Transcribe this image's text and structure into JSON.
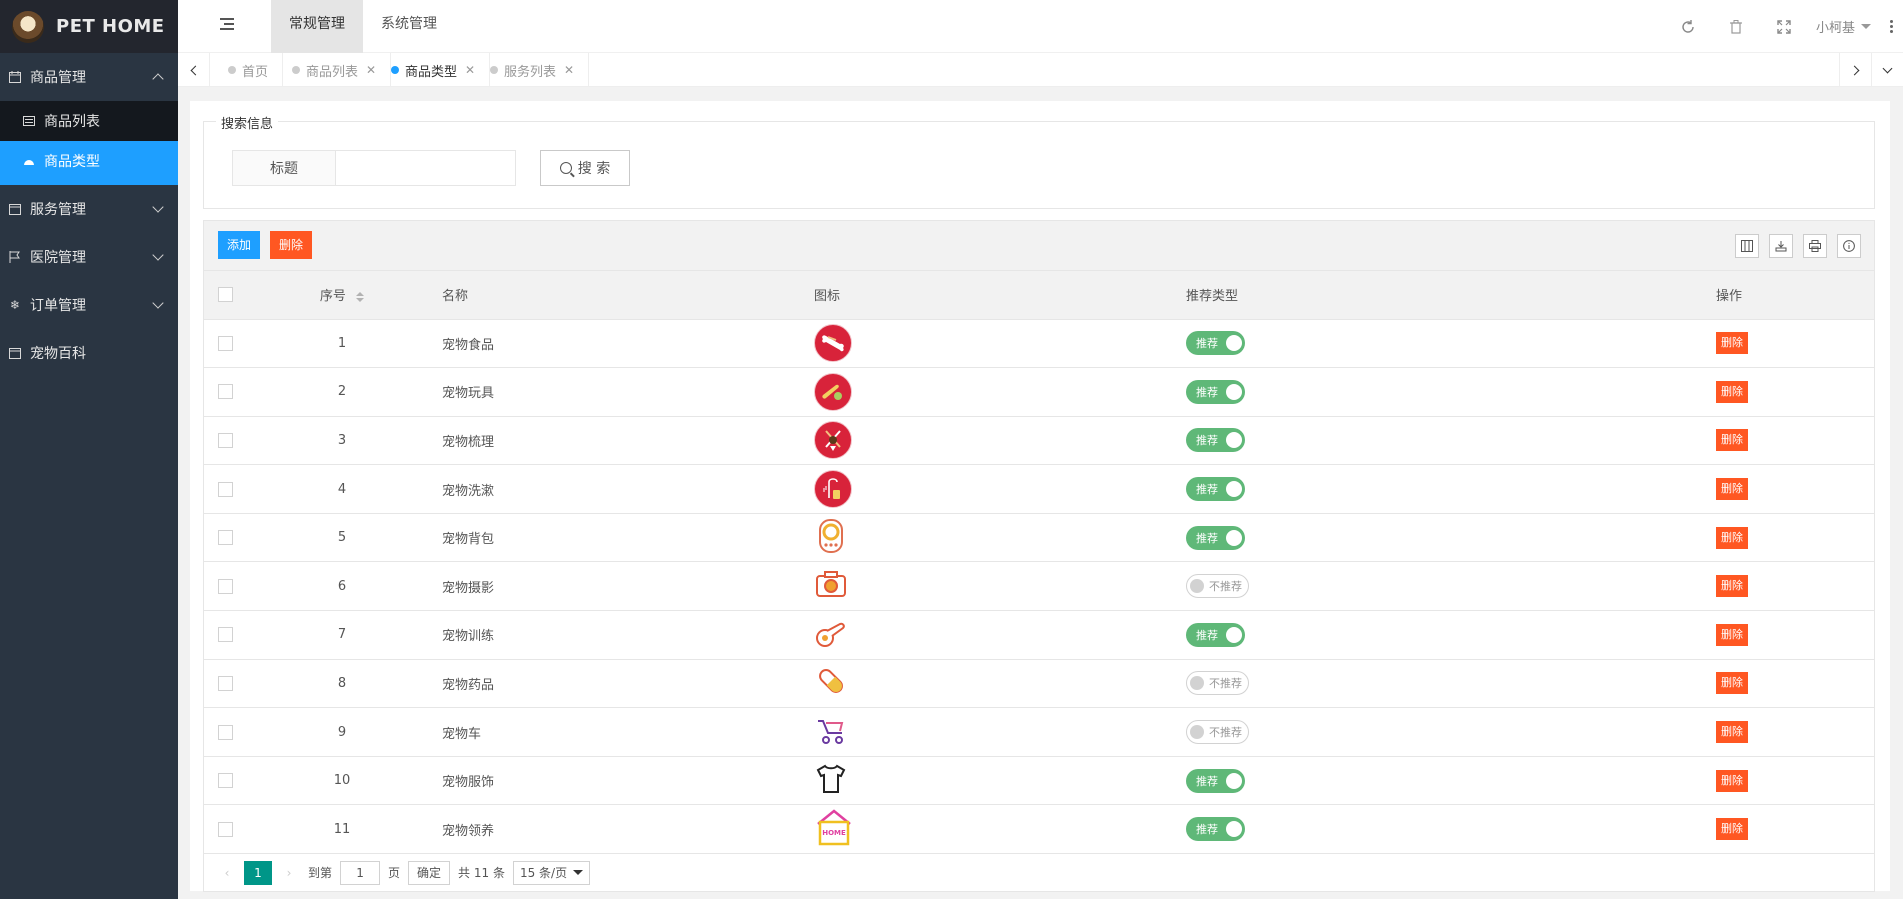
{
  "app": {
    "title": "PET HOME"
  },
  "sidebar": {
    "items": [
      {
        "label": "商品管理",
        "icon": "calendar-icon"
      },
      {
        "label": "服务管理",
        "icon": "calendar-icon"
      },
      {
        "label": "医院管理",
        "icon": "flag-icon"
      },
      {
        "label": "订单管理",
        "icon": "snowflake-icon"
      },
      {
        "label": "宠物百科",
        "icon": "calendar-icon"
      }
    ],
    "subitems": [
      {
        "label": "商品列表",
        "icon": "list-icon"
      },
      {
        "label": "商品类型",
        "icon": "dashboard-icon"
      }
    ]
  },
  "header": {
    "tabs": [
      {
        "label": "常规管理"
      },
      {
        "label": "系统管理"
      }
    ],
    "user": "小柯基"
  },
  "pagetabs": [
    {
      "label": "首页"
    },
    {
      "label": "商品列表"
    },
    {
      "label": "商品类型"
    },
    {
      "label": "服务列表"
    }
  ],
  "search": {
    "legend": "搜索信息",
    "label": "标题",
    "value": "",
    "button": "搜 索"
  },
  "toolbar": {
    "add": "添加",
    "delete": "删除"
  },
  "table": {
    "headers": {
      "num": "序号",
      "name": "名称",
      "icon": "图标",
      "rec": "推荐类型",
      "op": "操作"
    },
    "rows": [
      {
        "num": "1",
        "name": "宠物食品",
        "icon": "bone-icon",
        "rec": "推荐",
        "on": true,
        "op": "删除"
      },
      {
        "num": "2",
        "name": "宠物玩具",
        "icon": "ball-toy-icon",
        "rec": "推荐",
        "on": true,
        "op": "删除"
      },
      {
        "num": "3",
        "name": "宠物梳理",
        "icon": "grooming-icon",
        "rec": "推荐",
        "on": true,
        "op": "删除"
      },
      {
        "num": "4",
        "name": "宠物洗漱",
        "icon": "shower-icon",
        "rec": "推荐",
        "on": true,
        "op": "删除"
      },
      {
        "num": "5",
        "name": "宠物背包",
        "icon": "backpack-icon",
        "rec": "推荐",
        "on": true,
        "op": "删除"
      },
      {
        "num": "6",
        "name": "宠物摄影",
        "icon": "camera-icon",
        "rec": "不推荐",
        "on": false,
        "op": "删除"
      },
      {
        "num": "7",
        "name": "宠物训练",
        "icon": "whistle-icon",
        "rec": "推荐",
        "on": true,
        "op": "删除"
      },
      {
        "num": "8",
        "name": "宠物药品",
        "icon": "pill-icon",
        "rec": "不推荐",
        "on": false,
        "op": "删除"
      },
      {
        "num": "9",
        "name": "宠物车",
        "icon": "stroller-icon",
        "rec": "不推荐",
        "on": false,
        "op": "删除"
      },
      {
        "num": "10",
        "name": "宠物服饰",
        "icon": "tshirt-icon",
        "rec": "推荐",
        "on": true,
        "op": "删除"
      },
      {
        "num": "11",
        "name": "宠物领养",
        "icon": "home-house-icon",
        "rec": "推荐",
        "on": true,
        "op": "删除"
      }
    ]
  },
  "pager": {
    "current": "1",
    "goto_label": "到第",
    "goto_value": "1",
    "page_label": "页",
    "ok": "确定",
    "total": "共 11 条",
    "per_page": "15 条/页"
  },
  "colors": {
    "sidebar": "#2a3542",
    "accent": "#1e9fff",
    "danger": "#ff5722",
    "success": "#5fb878",
    "pager": "#009688"
  }
}
